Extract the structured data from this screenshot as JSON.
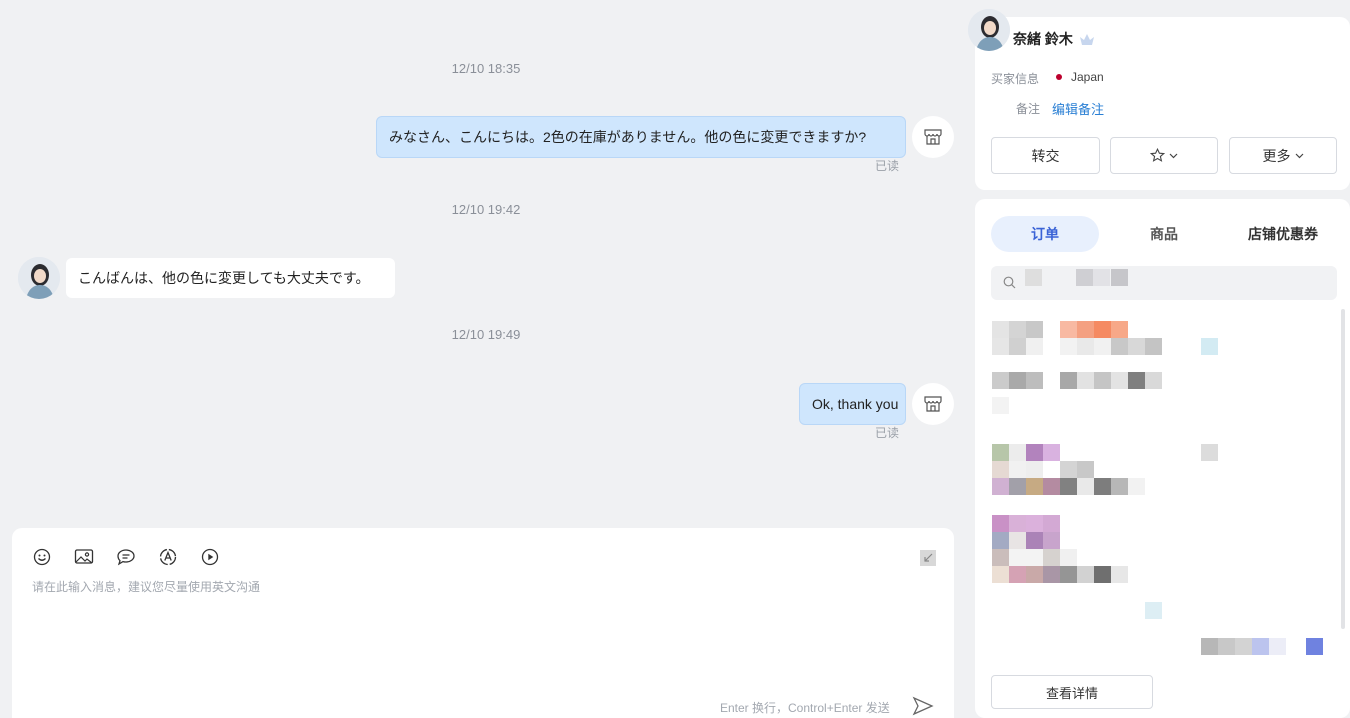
{
  "chat": {
    "messages": [
      {
        "time": "12/10 18:35",
        "from": "me",
        "text": "みなさん、こんにちは。2色の在庫がありません。他の色に変更できますか?",
        "status": "已读"
      },
      {
        "time": "12/10 19:42",
        "from": "buyer",
        "text": "こんばんは、他の色に変更しても大丈夫です。"
      },
      {
        "time": "12/10 19:49",
        "from": "me",
        "text": "Ok, thank you",
        "status": "已读"
      }
    ]
  },
  "composer": {
    "placeholder": "请在此输入消息，建议您尽量使用英文沟通",
    "hint": "Enter 换行，Control+Enter 发送",
    "tools": [
      "emoji-icon",
      "image-icon",
      "quick-reply-icon",
      "translate-icon",
      "video-icon"
    ]
  },
  "buyer": {
    "name": "奈緒 鈴木",
    "info_label": "买家信息",
    "country": "Japan",
    "country_color": "#bc002d",
    "note_label": "备注",
    "note_link": "编辑备注"
  },
  "actions": {
    "transfer": "转交",
    "favorite_icon": "star-icon",
    "more": "更多"
  },
  "tabs": [
    "订单",
    "商品",
    "店铺优惠券"
  ],
  "order": {
    "view_details": "查看详情"
  },
  "colors": {
    "accent": "#3a63d6",
    "link": "#2a7fd4",
    "my_bubble": "#cfe6fd"
  }
}
